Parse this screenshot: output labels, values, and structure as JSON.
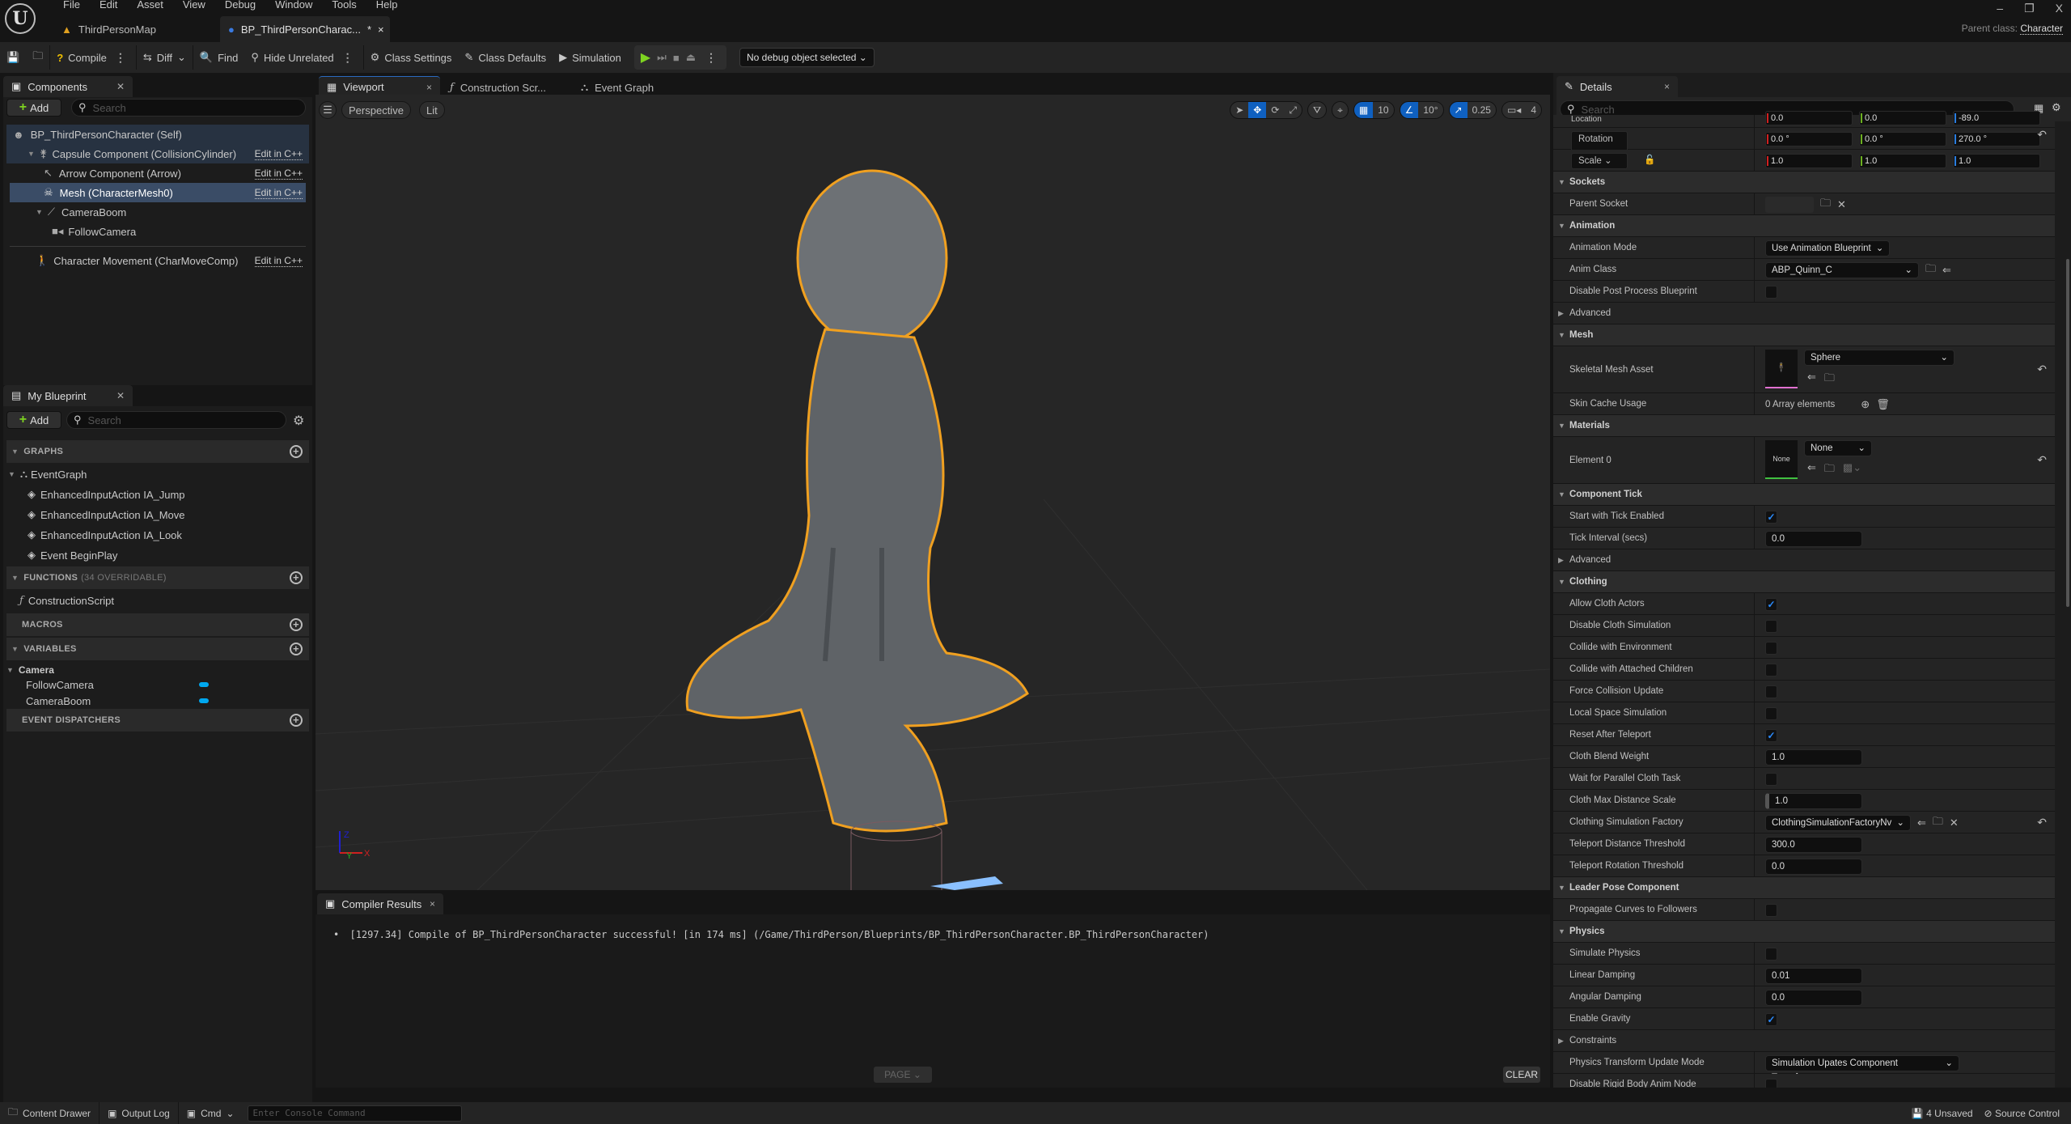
{
  "menu": [
    "File",
    "Edit",
    "Asset",
    "View",
    "Debug",
    "Window",
    "Tools",
    "Help"
  ],
  "doc_tabs": [
    {
      "label": "ThirdPersonMap",
      "icon": "level-icon"
    },
    {
      "label": "BP_ThirdPersonCharac...",
      "dirty": "*",
      "close": "×",
      "icon": "blueprint-character-icon"
    }
  ],
  "window_controls": {
    "minimize": "–",
    "restore": "❐",
    "close": "X"
  },
  "parent_class": {
    "label": "Parent class:",
    "value": "Character"
  },
  "toolbar": {
    "compile": "Compile",
    "diff": "Diff",
    "find": "Find",
    "hide_unrelated": "Hide Unrelated",
    "class_settings": "Class Settings",
    "class_defaults": "Class Defaults",
    "simulation": "Simulation",
    "debug_object": "No debug object selected"
  },
  "components": {
    "title": "Components",
    "add": "Add",
    "search_placeholder": "Search",
    "rows": [
      {
        "label": "BP_ThirdPersonCharacter (Self)",
        "edit": ""
      },
      {
        "label": "Capsule Component (CollisionCylinder)",
        "edit": "Edit in C++"
      },
      {
        "label": "Arrow Component (Arrow)",
        "edit": "Edit in C++"
      },
      {
        "label": "Mesh (CharacterMesh0)",
        "edit": "Edit in C++"
      },
      {
        "label": "CameraBoom",
        "edit": ""
      },
      {
        "label": "FollowCamera",
        "edit": ""
      },
      {
        "label": "Character Movement (CharMoveComp)",
        "edit": "Edit in C++"
      }
    ]
  },
  "my_blueprint": {
    "title": "My Blueprint",
    "add": "Add",
    "search_placeholder": "Search",
    "graphs_header": "GRAPHS",
    "event_graph": "EventGraph",
    "events": [
      "EnhancedInputAction IA_Jump",
      "EnhancedInputAction IA_Move",
      "EnhancedInputAction IA_Look",
      "Event BeginPlay"
    ],
    "functions_header": "FUNCTIONS",
    "functions_count": "(34 OVERRIDABLE)",
    "functions": [
      "ConstructionScript"
    ],
    "macros_header": "MACROS",
    "variables_header": "VARIABLES",
    "var_category": "Camera",
    "variables": [
      "FollowCamera",
      "CameraBoom"
    ],
    "dispatchers_header": "EVENT DISPATCHERS"
  },
  "editor_tabs": [
    {
      "label": "Viewport",
      "close": "×"
    },
    {
      "label": "Construction Scr..."
    },
    {
      "label": "Event Graph"
    }
  ],
  "viewport": {
    "perspective": "Perspective",
    "lit": "Lit",
    "grid_snap": "10",
    "rot_snap": "10°",
    "scale_snap": "0.25",
    "camera_speed": "4",
    "axis": {
      "x": "X",
      "y": "Y",
      "z": "Z"
    }
  },
  "compiler": {
    "title": "Compiler Results",
    "close": "×",
    "message": "[1297.34] Compile of BP_ThirdPersonCharacter successful! [in 174 ms] (/Game/ThirdPerson/Blueprints/BP_ThirdPersonCharacter.BP_ThirdPersonCharacter)",
    "page": "PAGE",
    "clear": "CLEAR"
  },
  "details": {
    "title": "Details",
    "close": "×",
    "search_placeholder": "Search",
    "transform": {
      "location": {
        "label": "Location",
        "x": "0.0",
        "y": "0.0",
        "z": "-89.0"
      },
      "rotation": {
        "label": "Rotation",
        "x": "0.0 °",
        "y": "0.0 °",
        "z": "270.0 °"
      },
      "scale": {
        "label": "Scale",
        "x": "1.0",
        "y": "1.0",
        "z": "1.0"
      }
    },
    "sockets": {
      "header": "Sockets",
      "parent_socket": "Parent Socket"
    },
    "animation": {
      "header": "Animation",
      "mode_label": "Animation Mode",
      "mode_value": "Use Animation Blueprint",
      "class_label": "Anim Class",
      "class_value": "ABP_Quinn_C",
      "disable_pp_label": "Disable Post Process Blueprint",
      "disable_pp": false,
      "advanced": "Advanced"
    },
    "mesh": {
      "header": "Mesh",
      "asset_label": "Skeletal Mesh Asset",
      "asset_value": "Sphere",
      "skin_cache_label": "Skin Cache Usage",
      "skin_cache_value": "0 Array elements"
    },
    "materials": {
      "header": "Materials",
      "element_label": "Element 0",
      "element_thumb": "None",
      "element_value": "None"
    },
    "component_tick": {
      "header": "Component Tick",
      "start_label": "Start with Tick Enabled",
      "start": true,
      "interval_label": "Tick Interval (secs)",
      "interval": "0.0",
      "advanced": "Advanced"
    },
    "clothing": {
      "header": "Clothing",
      "checks": [
        {
          "label": "Allow Cloth Actors",
          "checked": true
        },
        {
          "label": "Disable Cloth Simulation",
          "checked": false
        },
        {
          "label": "Collide with Environment",
          "checked": false
        },
        {
          "label": "Collide with Attached Children",
          "checked": false
        },
        {
          "label": "Force Collision Update",
          "checked": false
        },
        {
          "label": "Local Space Simulation",
          "checked": false
        },
        {
          "label": "Reset After Teleport",
          "checked": true
        }
      ],
      "blend_label": "Cloth Blend Weight",
      "blend": "1.0",
      "wait_label": "Wait for Parallel Cloth Task",
      "wait": false,
      "max_dist_label": "Cloth Max Distance Scale",
      "max_dist": "1.0",
      "factory_label": "Clothing Simulation Factory",
      "factory": "ClothingSimulationFactoryNv",
      "tp_dist_label": "Teleport Distance Threshold",
      "tp_dist": "300.0",
      "tp_rot_label": "Teleport Rotation Threshold",
      "tp_rot": "0.0"
    },
    "leader_pose": {
      "header": "Leader Pose Component",
      "propagate_label": "Propagate Curves to Followers",
      "propagate": false
    },
    "physics": {
      "header": "Physics",
      "simulate_label": "Simulate Physics",
      "simulate": false,
      "linear_label": "Linear Damping",
      "linear": "0.01",
      "angular_label": "Angular Damping",
      "angular": "0.0",
      "gravity_label": "Enable Gravity",
      "gravity": true,
      "constraints": "Constraints",
      "update_mode_label": "Physics Transform Update Mode",
      "update_mode": "Simulation Upates Component Transform",
      "disable_rb_label": "Disable Rigid Body Anim Node"
    }
  },
  "statusbar": {
    "content_drawer": "Content Drawer",
    "output_log": "Output Log",
    "cmd": "Cmd",
    "console_placeholder": "Enter Console Command",
    "unsaved": "4 Unsaved",
    "source_control": "Source Control"
  }
}
